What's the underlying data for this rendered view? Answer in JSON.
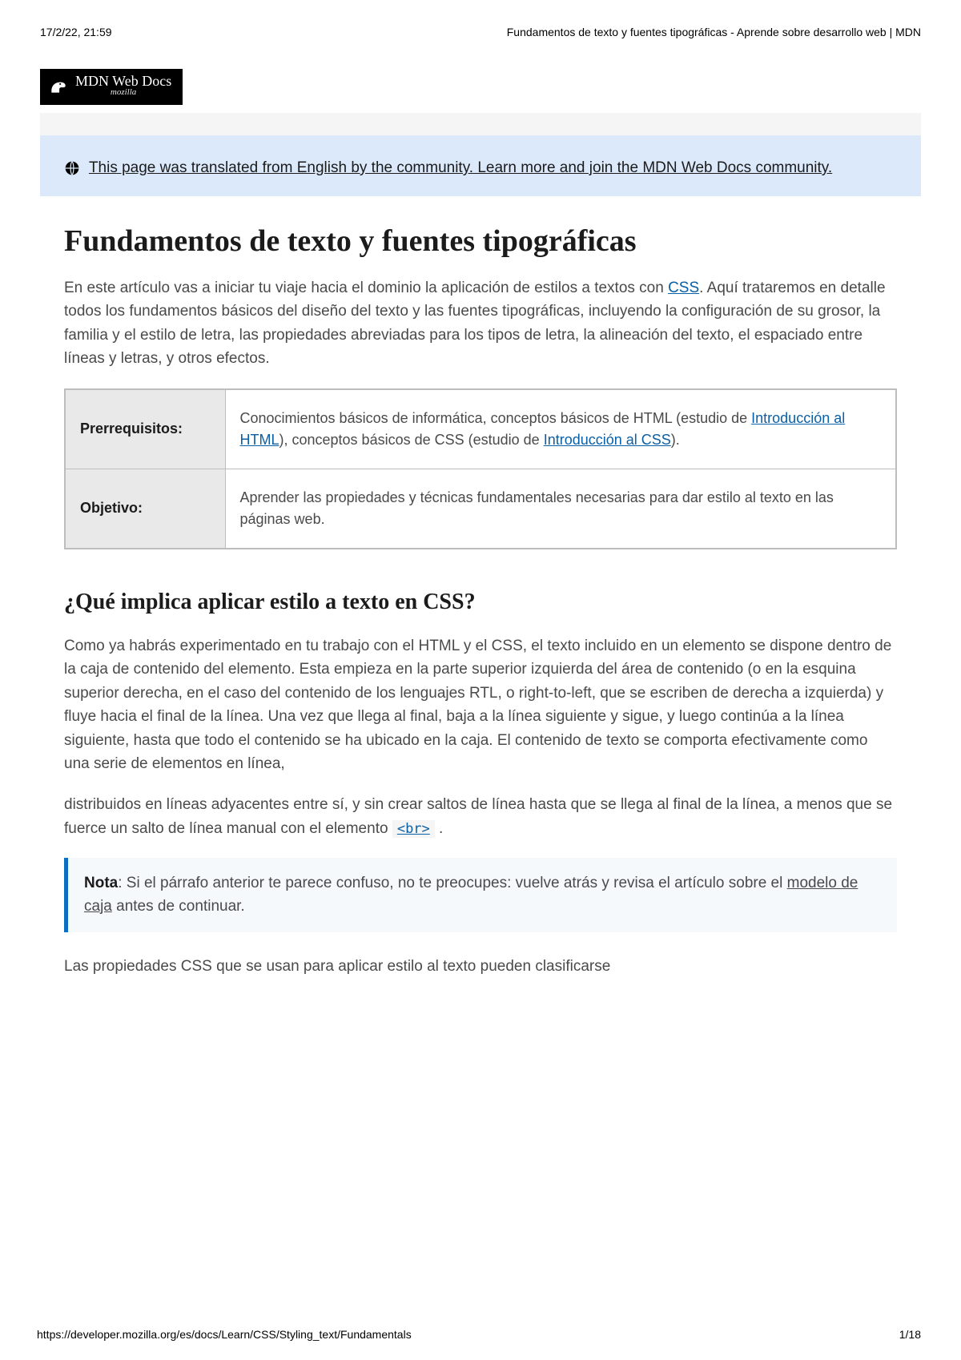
{
  "meta": {
    "timestamp": "17/2/22, 21:59",
    "page_title": "Fundamentos de texto y fuentes tipográficas - Aprende sobre desarrollo web | MDN"
  },
  "logo": {
    "main": "MDN Web Docs",
    "sub": "mozilla"
  },
  "banner": {
    "text": "This page was translated from English by the community. Learn more and join the MDN Web Docs community."
  },
  "article": {
    "heading": "Fundamentos de texto y fuentes tipográficas",
    "intro_before_link": "En este artículo vas a iniciar tu viaje hacia el dominio la aplicación de estilos a textos con ",
    "intro_link": "CSS",
    "intro_after_link": ". Aquí trataremos en detalle todos los fundamentos básicos del diseño del texto y las fuentes tipográficas, incluyendo la configuración de su grosor, la familia y el estilo de letra, las propiedades abreviadas para los tipos de letra, la alineación del texto, el espaciado entre líneas y letras, y otros efectos."
  },
  "table": {
    "row1": {
      "label": "Prerrequisitos:",
      "before_link1": "Conocimientos básicos de informática, conceptos básicos de HTML (estudio de ",
      "link1": "Introducción al HTML",
      "between": "), conceptos básicos de CSS (estudio de ",
      "link2": "Introducción al CSS",
      "after": ")."
    },
    "row2": {
      "label": "Objetivo:",
      "value": "Aprender las propiedades y técnicas fundamentales necesarias para dar estilo al texto en las páginas web."
    }
  },
  "section": {
    "heading": "¿Qué implica aplicar estilo a texto en CSS?",
    "para1": "Como ya habrás experimentado en tu trabajo con el HTML y el CSS, el texto incluido en un elemento se dispone dentro de la caja de contenido del elemento. Esta empieza en la parte superior izquierda del área de contenido (o en la esquina superior derecha, en el caso del contenido de los lenguajes RTL, o right-to-left, que se escriben de derecha a izquierda) y fluye hacia el final de la línea. Una vez que llega al final, baja a la línea siguiente y sigue, y luego continúa a la línea siguiente, hasta que todo el contenido se ha ubicado en la caja. El contenido de texto se comporta efectivamente como una serie de elementos en línea,",
    "para2_before": "distribuidos en líneas adyacentes entre sí, y sin crear saltos de línea hasta que se llega al final de la línea, a menos que se fuerce un salto de línea manual con el elemento ",
    "para2_code": "<br>",
    "para2_after": " ."
  },
  "note": {
    "label": "Nota",
    "before_link": ": Si el párrafo anterior te parece confuso, no te preocupes: vuelve atrás y revisa el artículo sobre el ",
    "link": "modelo de caja",
    "after_link": " antes de continuar."
  },
  "closing": "Las propiedades CSS que se usan para aplicar estilo al texto pueden clasificarse",
  "footer": {
    "url": "https://developer.mozilla.org/es/docs/Learn/CSS/Styling_text/Fundamentals",
    "page": "1/18"
  }
}
